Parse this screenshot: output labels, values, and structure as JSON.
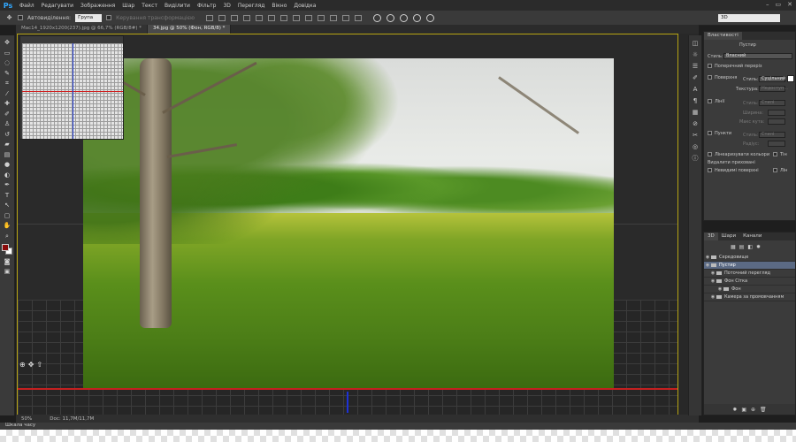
{
  "app": {
    "logo": "Ps"
  },
  "menu": [
    "Файл",
    "Редагувати",
    "Зображення",
    "Шар",
    "Текст",
    "Виділити",
    "Фільтр",
    "3D",
    "Перегляд",
    "Вікно",
    "Довідка"
  ],
  "window_controls": [
    "–",
    "▭",
    "✕"
  ],
  "options": {
    "auto_select_label": "Автовиділення:",
    "auto_select_value": "Група",
    "transform_label": "Керування трансформацією",
    "workspace": "3D"
  },
  "tabs": [
    {
      "label": "Mac14_1920x1200(237).jpg @ 66,7% (RGB/8#) *",
      "active": false
    },
    {
      "label": "34.jpg @ 50% (Фон, RGB/8) *",
      "active": true
    }
  ],
  "status": {
    "zoom": "50%",
    "doc": "Doc: 11,7M/11,7M"
  },
  "timeline": {
    "label": "Шкала часу"
  },
  "properties": {
    "tab": "Властивості",
    "header": "Пустир",
    "style_label": "Стиль:",
    "style_value": "Власний",
    "cross_section": "Поперечний переріз",
    "surface": {
      "label": "Поверхня",
      "style_label": "Стиль:",
      "style_value": "Суцільний",
      "texture_label": "Текстура:",
      "texture_value": "Недоступ..."
    },
    "mesh": {
      "label": "Лінії",
      "style_label": "Стиль:",
      "style_value": "Стилі",
      "width_label": "Ширина:",
      "angle_label": "Макс кута:"
    },
    "points": {
      "label": "Пункти",
      "style_label": "Стиль:",
      "style_value": "Стилі",
      "radius_label": "Радіус:"
    },
    "linearize": "Лінеаризувати кольори",
    "shadows": "Тін",
    "hidden_surfaces": "Видалити приховані",
    "backface": "Невидимі поверхні",
    "line": "Лін"
  },
  "layers": {
    "tabs": [
      "3D",
      "Шари",
      "Канали"
    ],
    "rows": [
      {
        "label": "Середовище",
        "selected": false
      },
      {
        "label": "Пустир",
        "selected": true
      },
      {
        "label": "Поточний перегляд",
        "selected": false
      },
      {
        "label": "Фон Сітка",
        "selected": false
      },
      {
        "label": "Фон",
        "selected": false
      },
      {
        "label": "Камера за промовчанням",
        "selected": false
      }
    ]
  },
  "colors": {
    "foreground": "#8b0a0a",
    "background": "#ffffff",
    "selection": "#5b6a84",
    "canvas_border": "#b7a413"
  }
}
